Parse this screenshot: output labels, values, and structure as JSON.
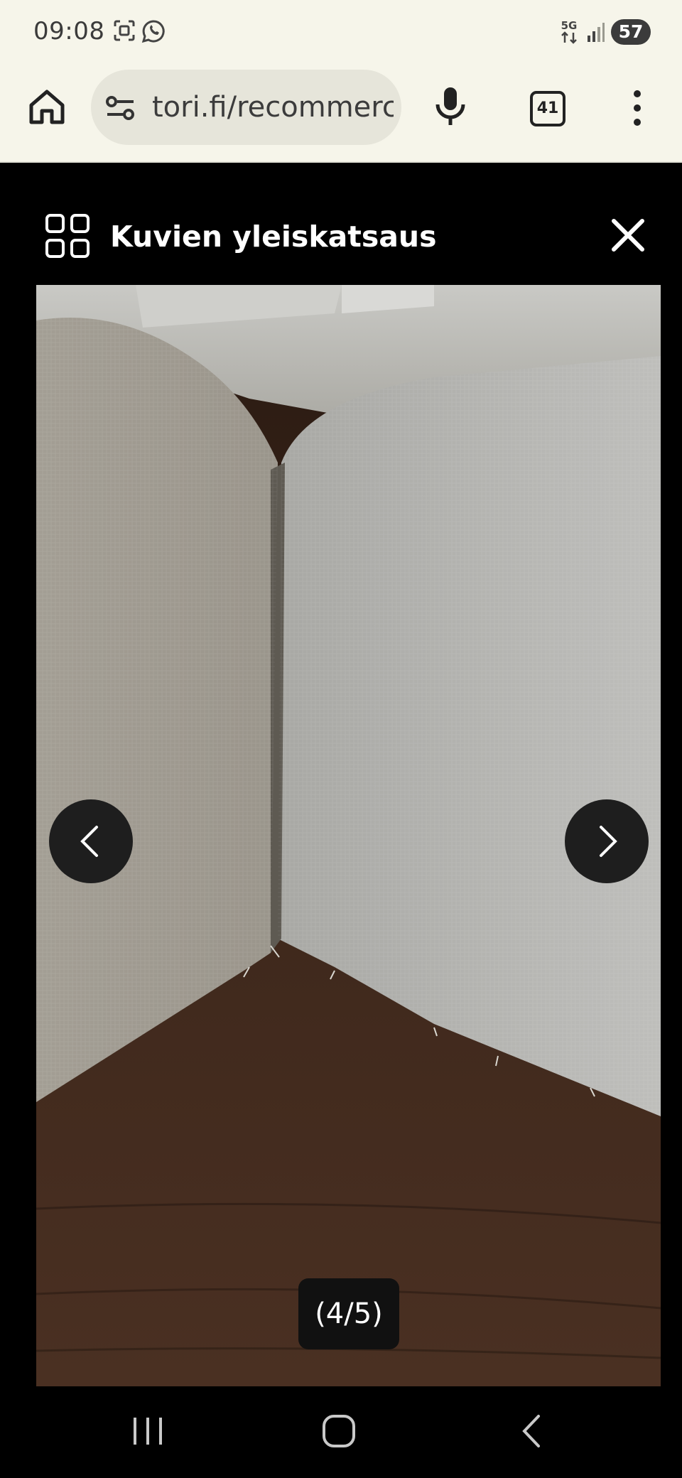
{
  "status_bar": {
    "time": "09:08",
    "network": "5G",
    "battery": "57",
    "icons": [
      "screenshot-icon",
      "whatsapp-icon",
      "network-5g-icon",
      "signal-icon",
      "battery-icon"
    ]
  },
  "browser": {
    "url": "tori.fi/recommerc",
    "tab_count": "41",
    "icons": [
      "home-icon",
      "site-settings-icon",
      "mic-icon",
      "tabs-icon",
      "more-menu-icon"
    ]
  },
  "viewer": {
    "title": "Kuvien yleiskatsaus",
    "counter": "(4/5)",
    "current_image": 4,
    "total_images": 5,
    "icons": [
      "grid-icon",
      "close-icon",
      "chevron-left-icon",
      "chevron-right-icon"
    ]
  },
  "system_nav": {
    "icons": [
      "recents-icon",
      "home-circle-icon",
      "back-icon"
    ]
  },
  "colors": {
    "status_bg": "#f6f5ea",
    "url_box": "#e6e5da",
    "viewer_bg": "#000000",
    "arrow_bg": "#1e1e1e"
  }
}
